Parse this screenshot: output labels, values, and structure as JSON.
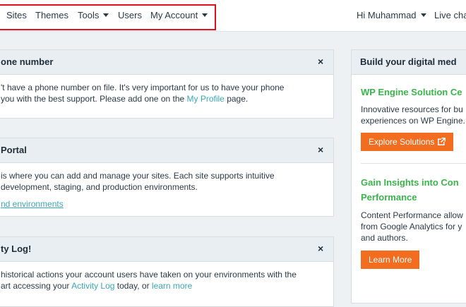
{
  "nav": {
    "sites": "Sites",
    "themes": "Themes",
    "tools": "Tools",
    "users": "Users",
    "my_account": "My Account",
    "greeting": "Hi Muhammad",
    "live_chat": "Live chat"
  },
  "phone_card": {
    "title": "one number",
    "line1": "'t have a phone number on file. It's very important for us to have your phone",
    "line2_pre": "you with the best support. Please add one on the ",
    "line2_link": "My Profile",
    "line2_post": " page."
  },
  "portal_card": {
    "title": "Portal",
    "line1": "is where you can add and manage your sites. Each site supports intuitive",
    "line2": "development, staging, and production environments.",
    "link": "nd environments"
  },
  "activity_card": {
    "title": "ty Log!",
    "line1": "historical actions your account users have taken on your environments with the",
    "line2_pre": "art accessing your ",
    "line2_link1": "Activity Log",
    "line2_mid": " today, or ",
    "line2_link2": "learn more"
  },
  "right_card": {
    "title": "Build your digital med",
    "section1": {
      "heading": "WP Engine Solution Ce",
      "text1": "Innovative resources for bu",
      "text2": "experiences on WP Engine.",
      "button": "Explore Solutions"
    },
    "section2": {
      "heading1": "Gain Insights into Con",
      "heading2": "Performance",
      "text1": "Content Performance allow",
      "text2": "from Google Analytics for y",
      "text3": "and authors.",
      "button": "Learn More"
    }
  },
  "icons": {
    "close": "×",
    "caret": "caret-down-icon",
    "external": "external-link-icon"
  },
  "colors": {
    "accent_orange": "#f36d21",
    "link_teal": "#3aa7b9",
    "heading_green": "#39b54a",
    "highlight_red": "#e0101e"
  }
}
